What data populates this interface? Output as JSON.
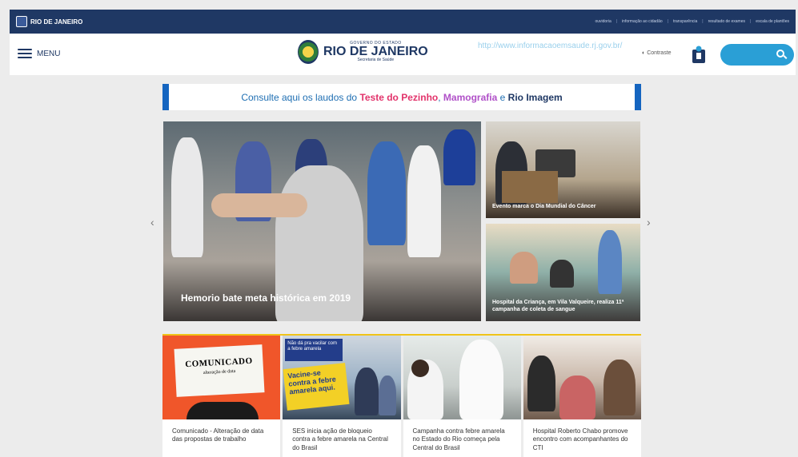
{
  "topbar": {
    "logo_text": "RIO DE JANEIRO",
    "links": [
      "ouvidoria",
      "informação ao cidadão",
      "transparência",
      "resultado de exames",
      "escala de plantões"
    ]
  },
  "header": {
    "menu_label": "MENU",
    "brand_gov": "GOVERNO DO ESTADO",
    "brand_name": "RIO DE JANEIRO",
    "brand_sec": "Secretaria de Saúde",
    "url_text": "http://www.informacaoemsaude.rj.gov.br/",
    "contrast_label": "Contraste",
    "search_placeholder": ""
  },
  "banner": {
    "prefix": "Consulte aqui os laudos do ",
    "pezinho": "Teste do Pezinho",
    "sep": ", ",
    "mamografia": "Mamografia",
    "and": " e ",
    "rio_imagem": "Rio Imagem"
  },
  "slider": {
    "main_caption": "Hemorio bate meta histórica em 2019",
    "side1_caption": "Evento marca o Dia Mundial do Câncer",
    "side2_caption": "Hospital da Criança, em Vila Valqueire, realiza 11ª campanha de coleta de sangue",
    "prev": "‹",
    "next": "›"
  },
  "cards": [
    {
      "text": "Comunicado - Alteração de data das propostas de trabalho",
      "img_title": "COMUNICADO",
      "img_sub": "alteração de data"
    },
    {
      "text": "SES inicia ação de bloqueio contra a febre amarela na Central do Brasil",
      "img_top": "Não dá pra vacilar com a febre amarela",
      "img_yellow": "Vacine-se contra a febre amarela aqui."
    },
    {
      "text": "Campanha contra febre amarela no Estado do Rio começa pela Central do Brasil"
    },
    {
      "text": "Hospital Roberto Chabo promove encontro com acompanhantes do CTI"
    }
  ],
  "colors": {
    "navy": "#1f3864",
    "accent_blue": "#2a9fd6",
    "pink": "#e2336b",
    "purple": "#b050c8"
  }
}
